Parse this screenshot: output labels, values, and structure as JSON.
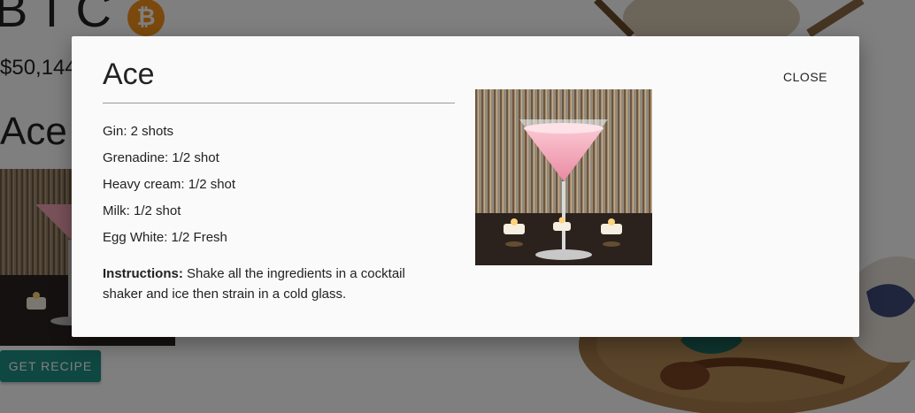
{
  "background": {
    "symbol": "BTC",
    "coin_glyph": "₿",
    "price": "$50,144",
    "title": "Ace",
    "get_recipe_label": "GET RECIPE",
    "accent_color": "#1e8f84",
    "coin_color": "#f7931a"
  },
  "modal": {
    "title": "Ace",
    "close_label": "CLOSE",
    "ingredients": [
      "Gin: 2 shots",
      "Grenadine: 1/2 shot",
      "Heavy cream: 1/2 shot",
      "Milk: 1/2 shot",
      "Egg White: 1/2 Fresh"
    ],
    "instructions_label": "Instructions:",
    "instructions_text": " Shake all the ingredients in a cocktail shaker and ice then strain in a cold glass."
  }
}
